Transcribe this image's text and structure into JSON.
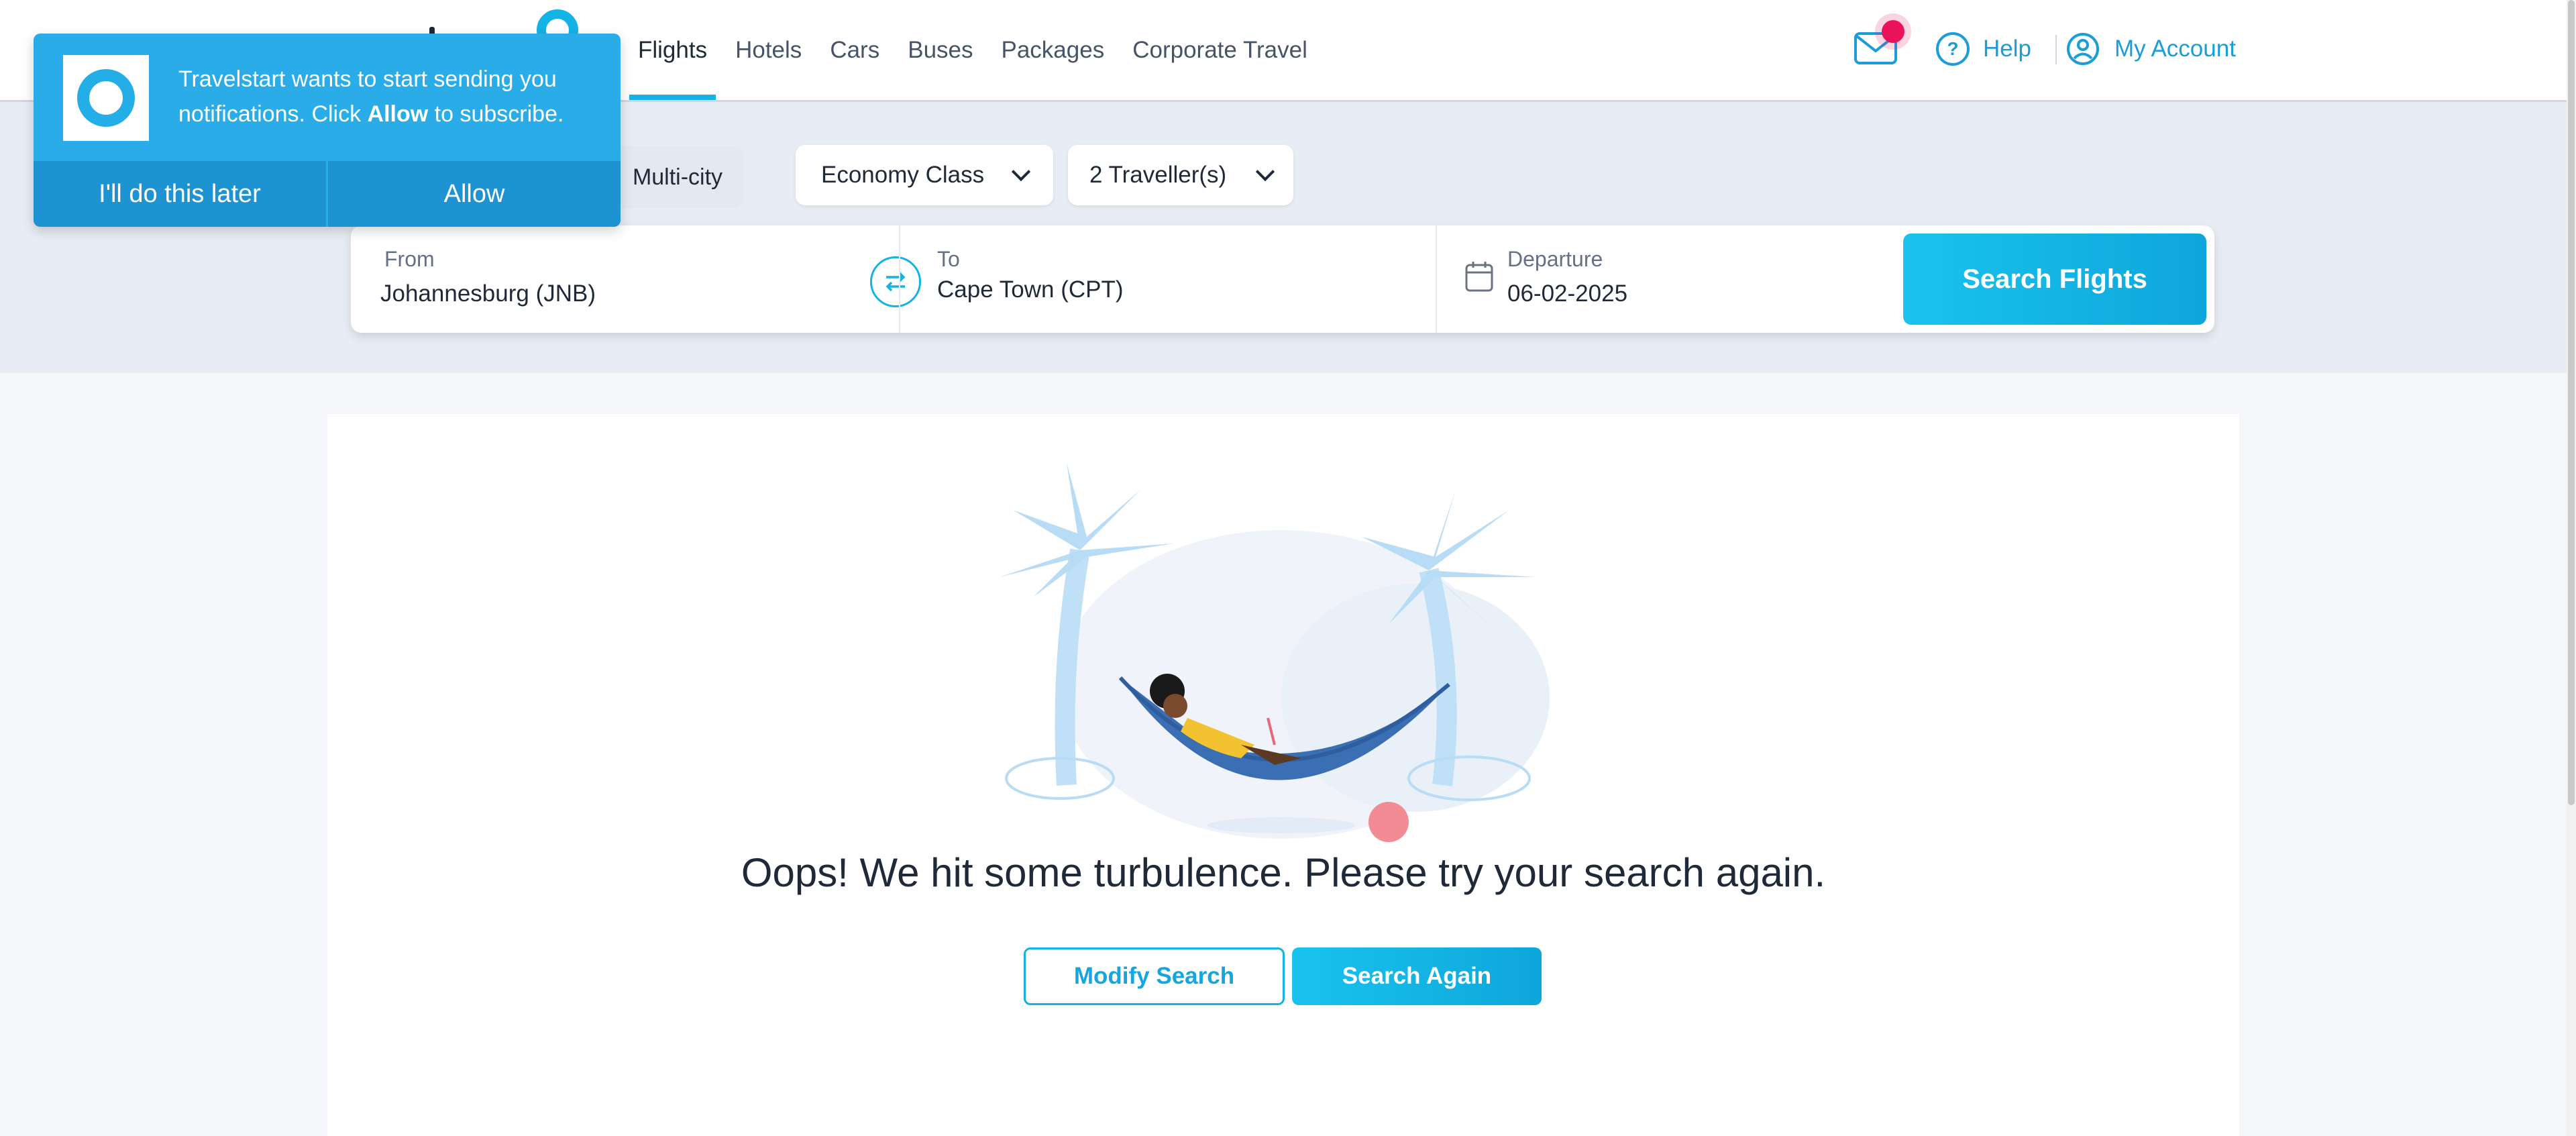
{
  "nav": {
    "items": [
      {
        "label": "Flights",
        "active": true
      },
      {
        "label": "Hotels",
        "active": false
      },
      {
        "label": "Cars",
        "active": false
      },
      {
        "label": "Buses",
        "active": false
      },
      {
        "label": "Packages",
        "active": false
      },
      {
        "label": "Corporate Travel",
        "active": false
      }
    ],
    "help_label": "Help",
    "account_label": "My Account"
  },
  "notification": {
    "text_before": "Travelstart wants to start sending you notifications. Click ",
    "text_bold": "Allow",
    "text_after": " to subscribe.",
    "later_label": "I'll do this later",
    "allow_label": "Allow"
  },
  "search": {
    "trip_type": "Multi-city",
    "cabin_class": "Economy Class",
    "travellers": "2 Traveller(s)",
    "from_label": "From",
    "from_value": "Johannesburg (JNB)",
    "to_label": "To",
    "to_value": "Cape Town (CPT)",
    "departure_label": "Departure",
    "departure_value": "06-02-2025",
    "search_button": "Search Flights"
  },
  "error": {
    "message": "Oops! We hit some turbulence. Please try your search again.",
    "modify_label": "Modify Search",
    "again_label": "Search Again"
  },
  "colors": {
    "accent": "#14b3e6",
    "notification_bg": "#2aace8",
    "badge": "#e8135b",
    "link": "#1a9dd9"
  }
}
